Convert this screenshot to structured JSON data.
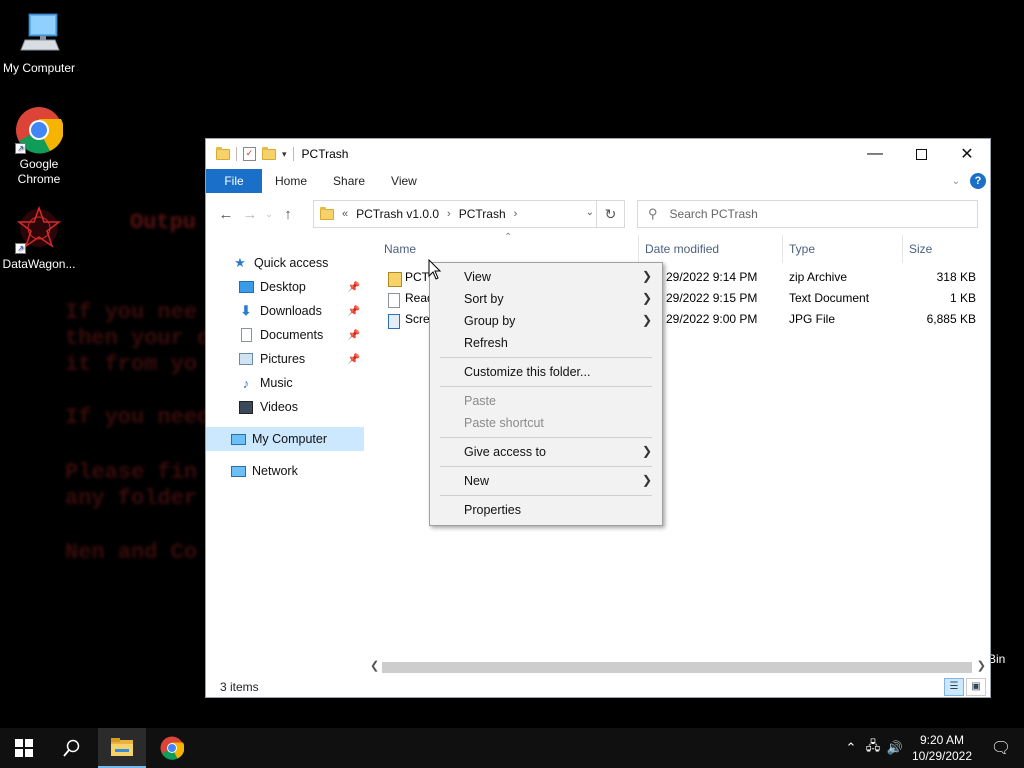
{
  "desktop": {
    "icons": [
      {
        "label": "My Computer"
      },
      {
        "label": "Google Chrome"
      },
      {
        "label": "DataWagon..."
      }
    ],
    "partial_label": "Bin",
    "background_text": [
      "Outpu",
      "If you nee",
      "then your d",
      "it from yo",
      "If you need",
      "Please fin",
      "any folder",
      "Nen and Co"
    ]
  },
  "window": {
    "title": "PCTrash",
    "ribbon_tabs": [
      "File",
      "Home",
      "Share",
      "View"
    ],
    "address": {
      "overflow": "«",
      "crumbs": [
        "PCTrash v1.0.0",
        "PCTrash"
      ]
    },
    "search_placeholder": "Search PCTrash",
    "nav": [
      {
        "label": "Quick access",
        "icon": "star-icon"
      },
      {
        "label": "Desktop",
        "icon": "desktop-icon",
        "pinned": true
      },
      {
        "label": "Downloads",
        "icon": "download-icon",
        "pinned": true
      },
      {
        "label": "Documents",
        "icon": "documents-icon",
        "pinned": true
      },
      {
        "label": "Pictures",
        "icon": "pictures-icon",
        "pinned": true
      },
      {
        "label": "Music",
        "icon": "music-icon"
      },
      {
        "label": "Videos",
        "icon": "videos-icon"
      },
      {
        "label": "My Computer",
        "icon": "computer-icon",
        "selected": true
      },
      {
        "label": "Network",
        "icon": "network-icon"
      }
    ],
    "columns": [
      "Name",
      "Date modified",
      "Type",
      "Size"
    ],
    "files": [
      {
        "name": "PCTr",
        "date": "29/2022 9:14 PM",
        "type": "zip Archive",
        "size": "318 KB",
        "icon": "zip-icon"
      },
      {
        "name": "Read",
        "date": "29/2022 9:15 PM",
        "type": "Text Document",
        "size": "1 KB",
        "icon": "text-file-icon"
      },
      {
        "name": "Scree",
        "date": "29/2022 9:00 PM",
        "type": "JPG File",
        "size": "6,885 KB",
        "icon": "image-file-icon"
      }
    ],
    "status": "3 items"
  },
  "context_menu": {
    "items": [
      {
        "label": "View",
        "submenu": true
      },
      {
        "label": "Sort by",
        "submenu": true
      },
      {
        "label": "Group by",
        "submenu": true
      },
      {
        "label": "Refresh"
      },
      {
        "label": "Customize this folder..."
      },
      {
        "label": "Paste",
        "disabled": true
      },
      {
        "label": "Paste shortcut",
        "disabled": true
      },
      {
        "label": "Give access to",
        "submenu": true
      },
      {
        "label": "New",
        "submenu": true
      },
      {
        "label": "Properties"
      }
    ]
  },
  "taskbar": {
    "time": "9:20 AM",
    "date": "10/29/2022"
  },
  "colors": {
    "accent": "#1a6fc9",
    "selection": "#cce8ff",
    "taskbar": "#101010"
  }
}
